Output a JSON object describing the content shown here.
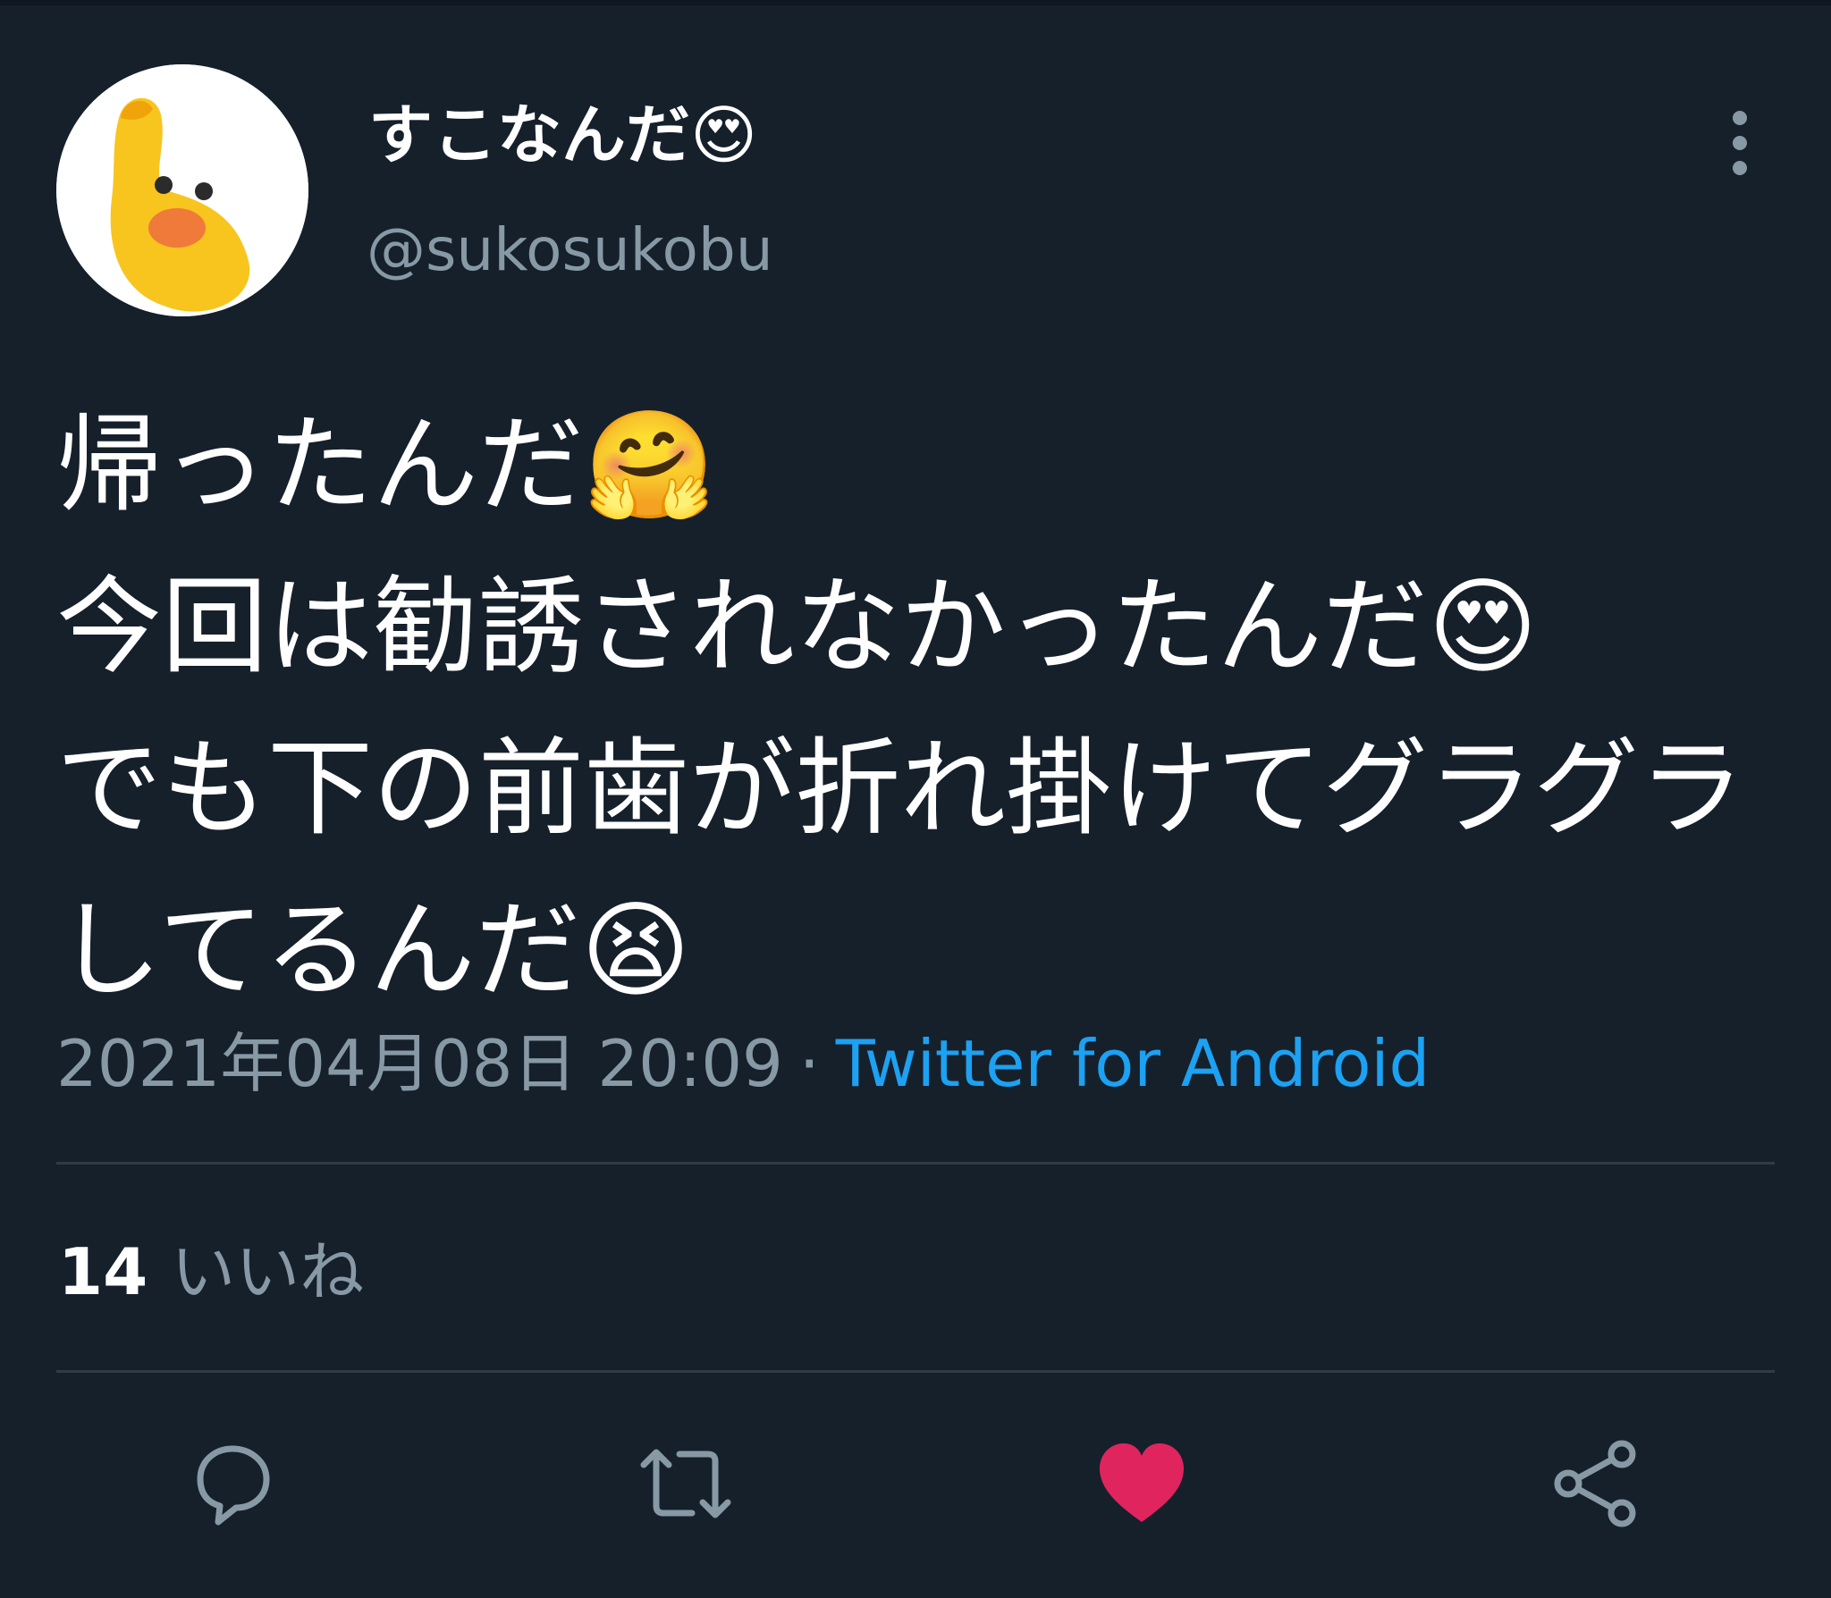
{
  "tweet": {
    "display_name": "すこなんだ😍",
    "handle": "@sukosukobu",
    "text_lines": [
      "帰ったんだ🤗",
      "今回は勧誘されなかったんだ😍",
      "でも下の前歯が折れ掛けてグラグラ",
      "してるんだ😫"
    ],
    "timestamp": "2021年04月08日 20:09",
    "separator": "·",
    "source": "Twitter for Android",
    "likes_count": "14",
    "likes_label": "いいね"
  },
  "icons": {
    "avatar": "waving-hand-emoji-icon",
    "more": "more-vertical-icon",
    "reply": "reply-icon",
    "retweet": "retweet-icon",
    "like": "heart-icon",
    "share": "share-icon"
  },
  "colors": {
    "background": "#15202b",
    "secondary_text": "#8899a6",
    "link": "#1da1f2",
    "like_active": "#e0245e",
    "divider": "#2f3b47"
  }
}
